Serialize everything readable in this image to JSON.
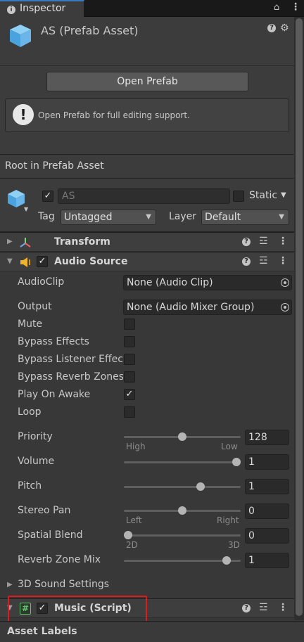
{
  "tab": {
    "label": "Inspector",
    "info_glyph": "i",
    "lock_glyph": "⌂",
    "menu_glyph": "⋮"
  },
  "header": {
    "title": "AS (Prefab Asset)",
    "open_prefab_label": "Open Prefab",
    "helpbox_text": "Open Prefab for full editing support.",
    "help_glyph": "?",
    "gear_glyph": "⚙",
    "warn_glyph": "!"
  },
  "root_label": "Root in Prefab Asset",
  "gameobject": {
    "active_check": "✓",
    "name": "AS",
    "static_label": "Static",
    "static_checked": "",
    "tag_label": "Tag",
    "tag_value": "Untagged",
    "layer_label": "Layer",
    "layer_value": "Default"
  },
  "glyphs": {
    "fold_closed": "▶",
    "fold_open": "▼",
    "dropdown": "▼",
    "check": "✓",
    "preset": "☲",
    "kebab": "⋮",
    "script_hash": "#"
  },
  "transform": {
    "title": "Transform"
  },
  "audio_source": {
    "title": "Audio Source",
    "enabled_check": "✓",
    "audioclip": {
      "label": "AudioClip",
      "value": "None (Audio Clip)"
    },
    "output": {
      "label": "Output",
      "value": "None (Audio Mixer Group)"
    },
    "toggles": [
      {
        "label": "Mute",
        "checked": ""
      },
      {
        "label": "Bypass Effects",
        "checked": ""
      },
      {
        "label": "Bypass Listener Effects",
        "checked": ""
      },
      {
        "label": "Bypass Reverb Zones",
        "checked": ""
      },
      {
        "label": "Play On Awake",
        "checked": "✓"
      },
      {
        "label": "Loop",
        "checked": ""
      }
    ],
    "sliders": [
      {
        "label": "Priority",
        "value": "128",
        "fraction": 0.5,
        "min_caption": "High",
        "max_caption": "Low"
      },
      {
        "label": "Volume",
        "value": "1",
        "fraction": 1.0,
        "min_caption": "",
        "max_caption": ""
      },
      {
        "label": "Pitch",
        "value": "1",
        "fraction": 0.667,
        "min_caption": "",
        "max_caption": ""
      },
      {
        "label": "Stereo Pan",
        "value": "0",
        "fraction": 0.5,
        "min_caption": "Left",
        "max_caption": "Right"
      },
      {
        "label": "Spatial Blend",
        "value": "0",
        "fraction": 0.0,
        "min_caption": "2D",
        "max_caption": "3D"
      },
      {
        "label": "Reverb Zone Mix",
        "value": "1",
        "fraction": 0.909,
        "min_caption": "",
        "max_caption": ""
      }
    ],
    "sound_settings_label": "3D Sound Settings"
  },
  "music_script": {
    "title": "Music (Script)",
    "enabled_check": "✓"
  },
  "asset_labels": "Asset Labels",
  "colors": {
    "accent_tab": "#3a79bb",
    "prefab_icon": "#6bb6e8",
    "audio_icon": "#f0b429",
    "highlight": "#e0191f",
    "script_icon": "#5fc36a"
  }
}
